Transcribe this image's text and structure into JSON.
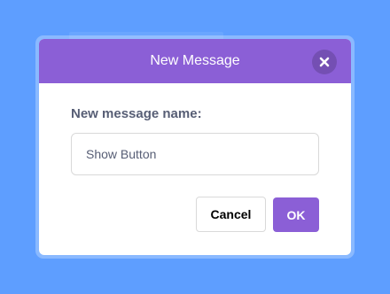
{
  "colors": {
    "background": "#5e9eff",
    "header": "#8b5fd6",
    "accent": "#8b5fd6",
    "label_text": "#575e75"
  },
  "dialog": {
    "title": "New Message",
    "close_icon": "close-icon",
    "field_label": "New message name:",
    "input": {
      "value": "Show Button",
      "placeholder": ""
    },
    "cancel_label": "Cancel",
    "ok_label": "OK"
  }
}
